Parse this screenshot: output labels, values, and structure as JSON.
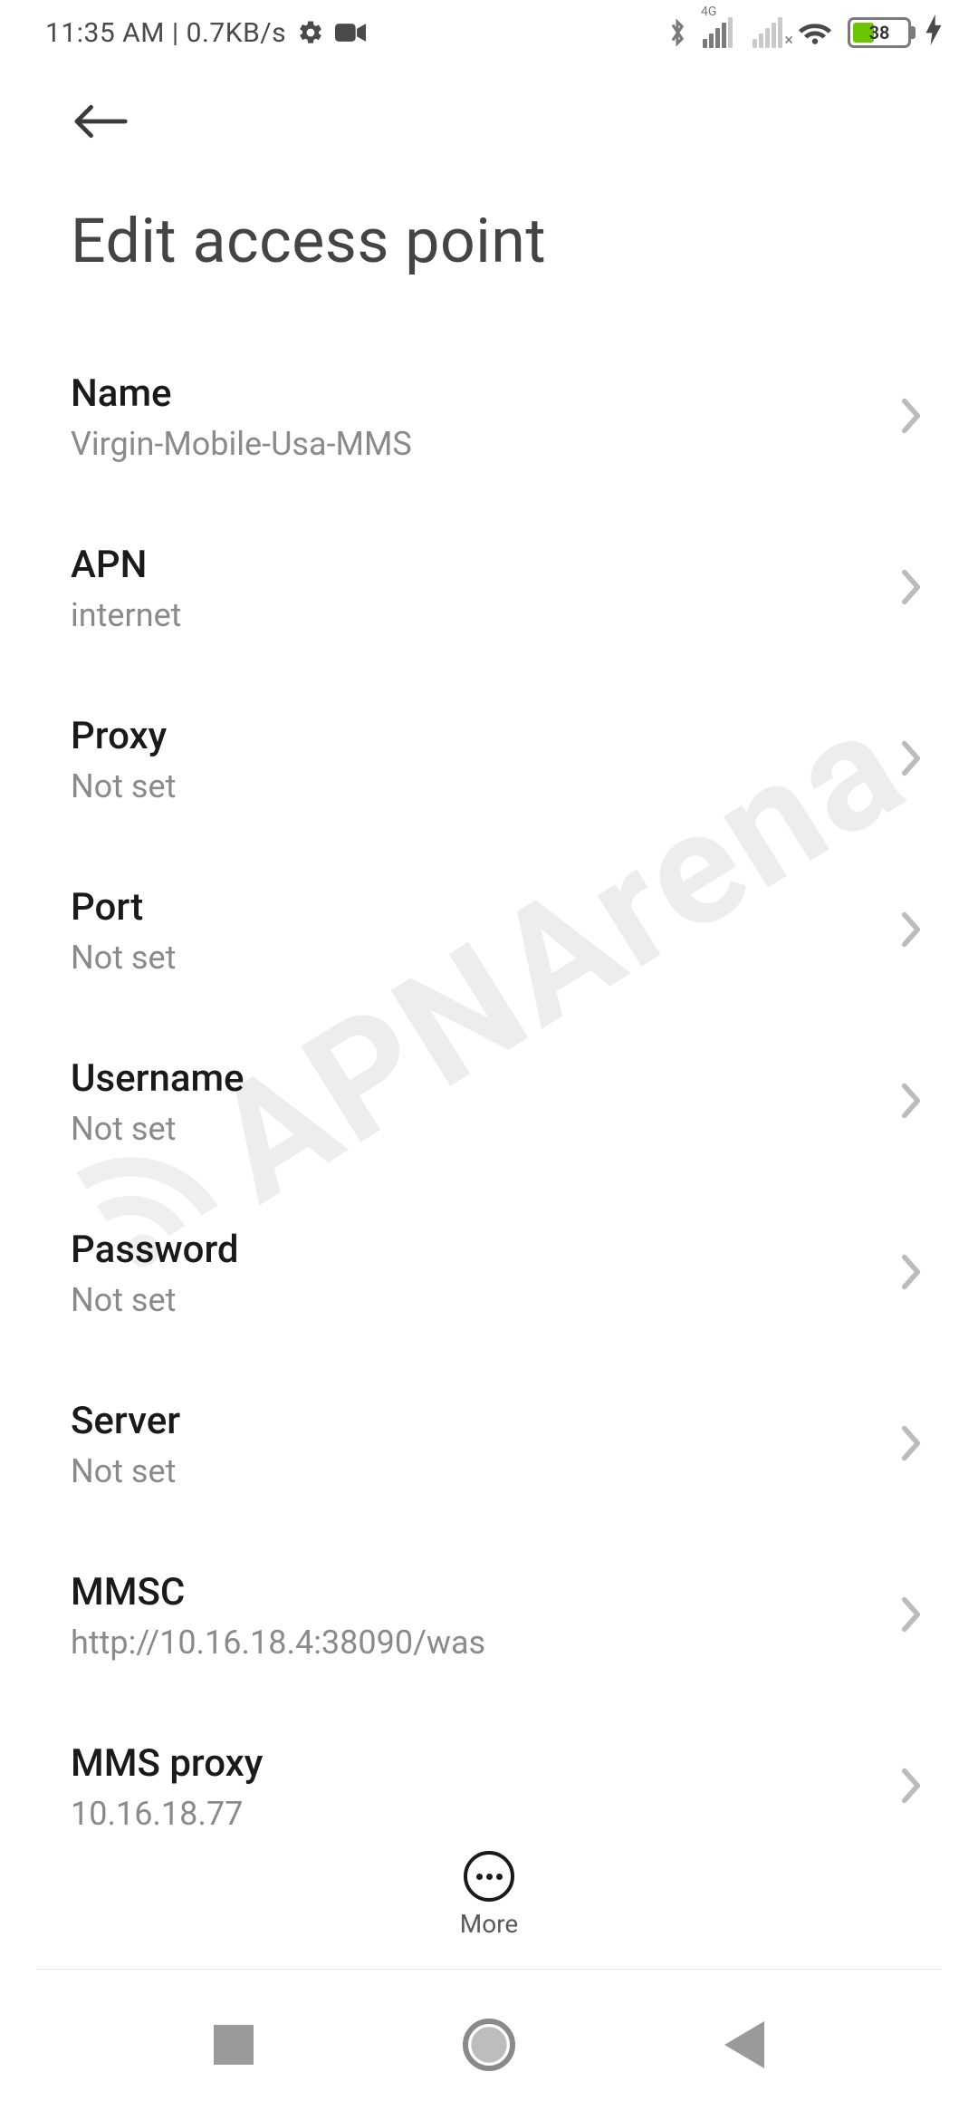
{
  "status": {
    "time": "11:35 AM",
    "net_speed": "0.7KB/s",
    "battery_percent": 38,
    "signal1_tech": "4G"
  },
  "page": {
    "title": "Edit access point"
  },
  "rows": [
    {
      "label": "Name",
      "value": "Virgin-Mobile-Usa-MMS"
    },
    {
      "label": "APN",
      "value": "internet"
    },
    {
      "label": "Proxy",
      "value": "Not set"
    },
    {
      "label": "Port",
      "value": "Not set"
    },
    {
      "label": "Username",
      "value": "Not set"
    },
    {
      "label": "Password",
      "value": "Not set"
    },
    {
      "label": "Server",
      "value": "Not set"
    },
    {
      "label": "MMSC",
      "value": "http://10.16.18.4:38090/was"
    },
    {
      "label": "MMS proxy",
      "value": "10.16.18.77"
    }
  ],
  "bottom": {
    "more_label": "More"
  },
  "watermark": {
    "text": "APNArena"
  }
}
